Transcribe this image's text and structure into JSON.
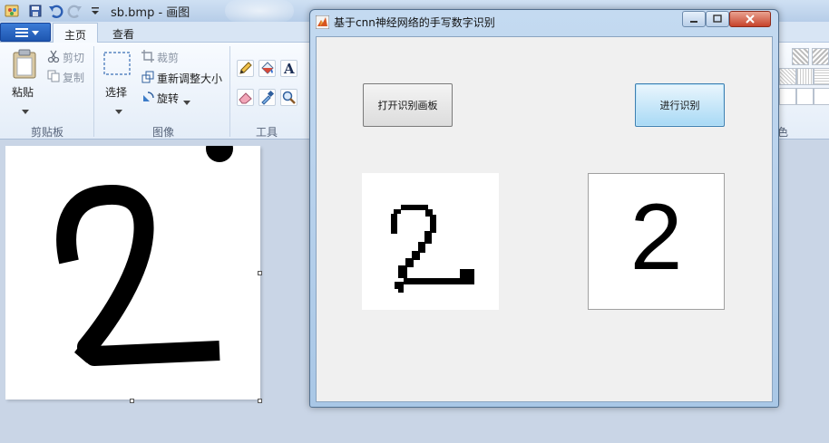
{
  "paint": {
    "title": "sb.bmp - 画图",
    "tabs": [
      {
        "label": "主页"
      },
      {
        "label": "查看"
      }
    ],
    "clipboard": {
      "paste_label": "粘贴",
      "cut_label": "剪切",
      "copy_label": "复制",
      "group_label": "剪贴板"
    },
    "image": {
      "select_label": "选择",
      "crop_label": "裁剪",
      "resize_label": "重新调整大小",
      "rotate_label": "旋转",
      "group_label": "图像"
    },
    "tools": {
      "group_label": "工具"
    },
    "colors": {
      "group_label_partial": "色"
    }
  },
  "figure": {
    "title": "基于cnn神经网络的手写数字识别",
    "open_button_label": "打开识别画板",
    "recognize_button_label": "进行识别",
    "result_digit": "2"
  },
  "theme": {
    "ribbon_accent": "#1e56b0",
    "recognize_button": "#a8d9f5",
    "close_button": "#c7432b"
  }
}
